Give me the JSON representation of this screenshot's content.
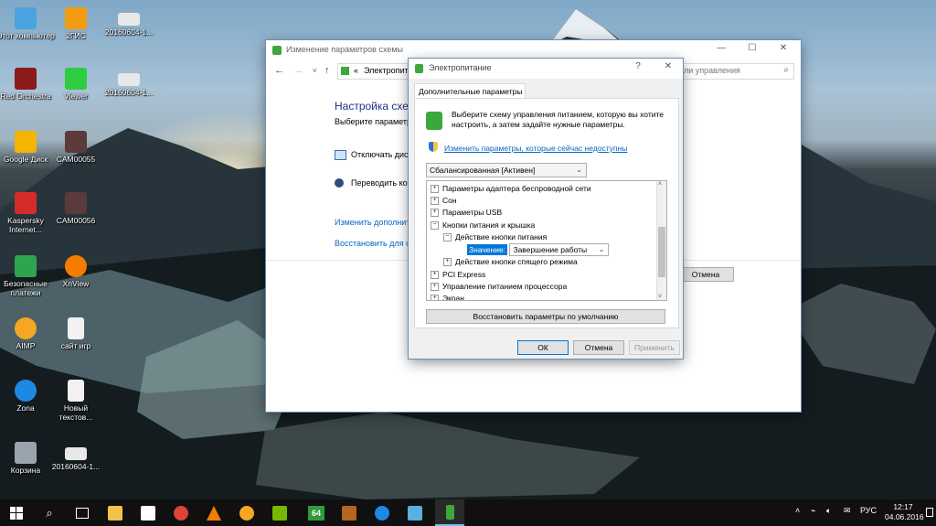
{
  "desktop_icons": [
    {
      "label": "Этот компьютер",
      "color": "#4aa3df"
    },
    {
      "label": "Red Orchestra",
      "color": "#8b1a1a"
    },
    {
      "label": "Google Диск",
      "color": "#f4b400"
    },
    {
      "label": "Kaspersky Internet...",
      "color": "#d62b2b"
    },
    {
      "label": "Безопасные платежи",
      "color": "#2ea44f"
    },
    {
      "label": "AIMP",
      "color": "#f5a623"
    },
    {
      "label": "Zona",
      "color": "#1e88e5"
    },
    {
      "label": "Корзина",
      "color": "#9aa4ad"
    },
    {
      "label": "2ГИС",
      "color": "#f39c12"
    },
    {
      "label": "Viewer",
      "color": "#2ecc40"
    },
    {
      "label": "CAM00055",
      "color": "#5a3a3a"
    },
    {
      "label": "CAM00056",
      "color": "#5a3a3a"
    },
    {
      "label": "XnView",
      "color": "#f57c00"
    },
    {
      "label": "сайт игр",
      "color": "#f2f2f2"
    },
    {
      "label": "Новый текстов...",
      "color": "#f2f2f2"
    },
    {
      "label": "20160604-1...",
      "color": "#e8e8e8"
    },
    {
      "label": "20160604-1...",
      "color": "#e8e8e8"
    },
    {
      "label": "20160604-1...",
      "color": "#e8e8e8"
    }
  ],
  "back_window": {
    "title": "Изменение параметров схемы",
    "address_prefix": "«",
    "address_path": "Электропит",
    "search_placeholder": "ли управления",
    "heading": "Настройка схем",
    "subtext": "Выберите параметр",
    "option1": "Отключать дис",
    "option2": "Переводить ко",
    "link1": "Изменить дополнит",
    "link2": "Восстановить для с",
    "cancel_button": "Отмена"
  },
  "dialog": {
    "title": "Электропитание",
    "help": "?",
    "close": "✕",
    "tab": "Дополнительные параметры",
    "description": "Выберите схему управления питанием, которую вы хотите настроить, а затем задайте нужные параметры.",
    "admin_link": "Изменить параметры, которые сейчас недоступны",
    "scheme_selected": "Сбалансированная [Активен]",
    "tree": [
      {
        "level": 0,
        "exp": "+",
        "text": "Параметры адаптера беспроводной сети"
      },
      {
        "level": 0,
        "exp": "+",
        "text": "Сон"
      },
      {
        "level": 0,
        "exp": "+",
        "text": "Параметры USB"
      },
      {
        "level": 0,
        "exp": "−",
        "text": "Кнопки питания и крышка"
      },
      {
        "level": 1,
        "exp": "−",
        "text": "Действие кнопки питания"
      },
      {
        "level": 1,
        "exp": "+",
        "text": "Действие кнопки спящего режима"
      },
      {
        "level": 0,
        "exp": "+",
        "text": "PCI Express"
      },
      {
        "level": 0,
        "exp": "+",
        "text": "Управление питанием процессора"
      },
      {
        "level": 0,
        "exp": "+",
        "text": "Экран"
      }
    ],
    "value_label": "Значение:",
    "value_selected": "Завершение работы",
    "restore_button": "Восстановить параметры по умолчанию",
    "ok_button": "ОК",
    "cancel_button": "Отмена",
    "apply_button": "Применить"
  },
  "taskbar": {
    "apps": [
      {
        "name": "file-explorer-icon",
        "color": "#f3c24b"
      },
      {
        "name": "store-icon",
        "color": "#ffffff"
      },
      {
        "name": "chrome-icon",
        "color": "#db4437"
      },
      {
        "name": "vlc-icon",
        "color": "#f57c00"
      },
      {
        "name": "aimp-icon",
        "color": "#f5a623"
      },
      {
        "name": "nvidia-icon",
        "color": "#76b900"
      },
      {
        "name": "app-64-icon",
        "color": "#2e9b3e"
      },
      {
        "name": "thumbs-icon",
        "color": "#b5651d"
      },
      {
        "name": "zona-icon",
        "color": "#1e88e5"
      },
      {
        "name": "tv-icon",
        "color": "#5ab0e0"
      },
      {
        "name": "battery-app-icon",
        "color": "#3aa83a"
      }
    ],
    "app64_label": "64",
    "lang": "РУС",
    "time": "12:17",
    "date": "04.06.2016"
  }
}
